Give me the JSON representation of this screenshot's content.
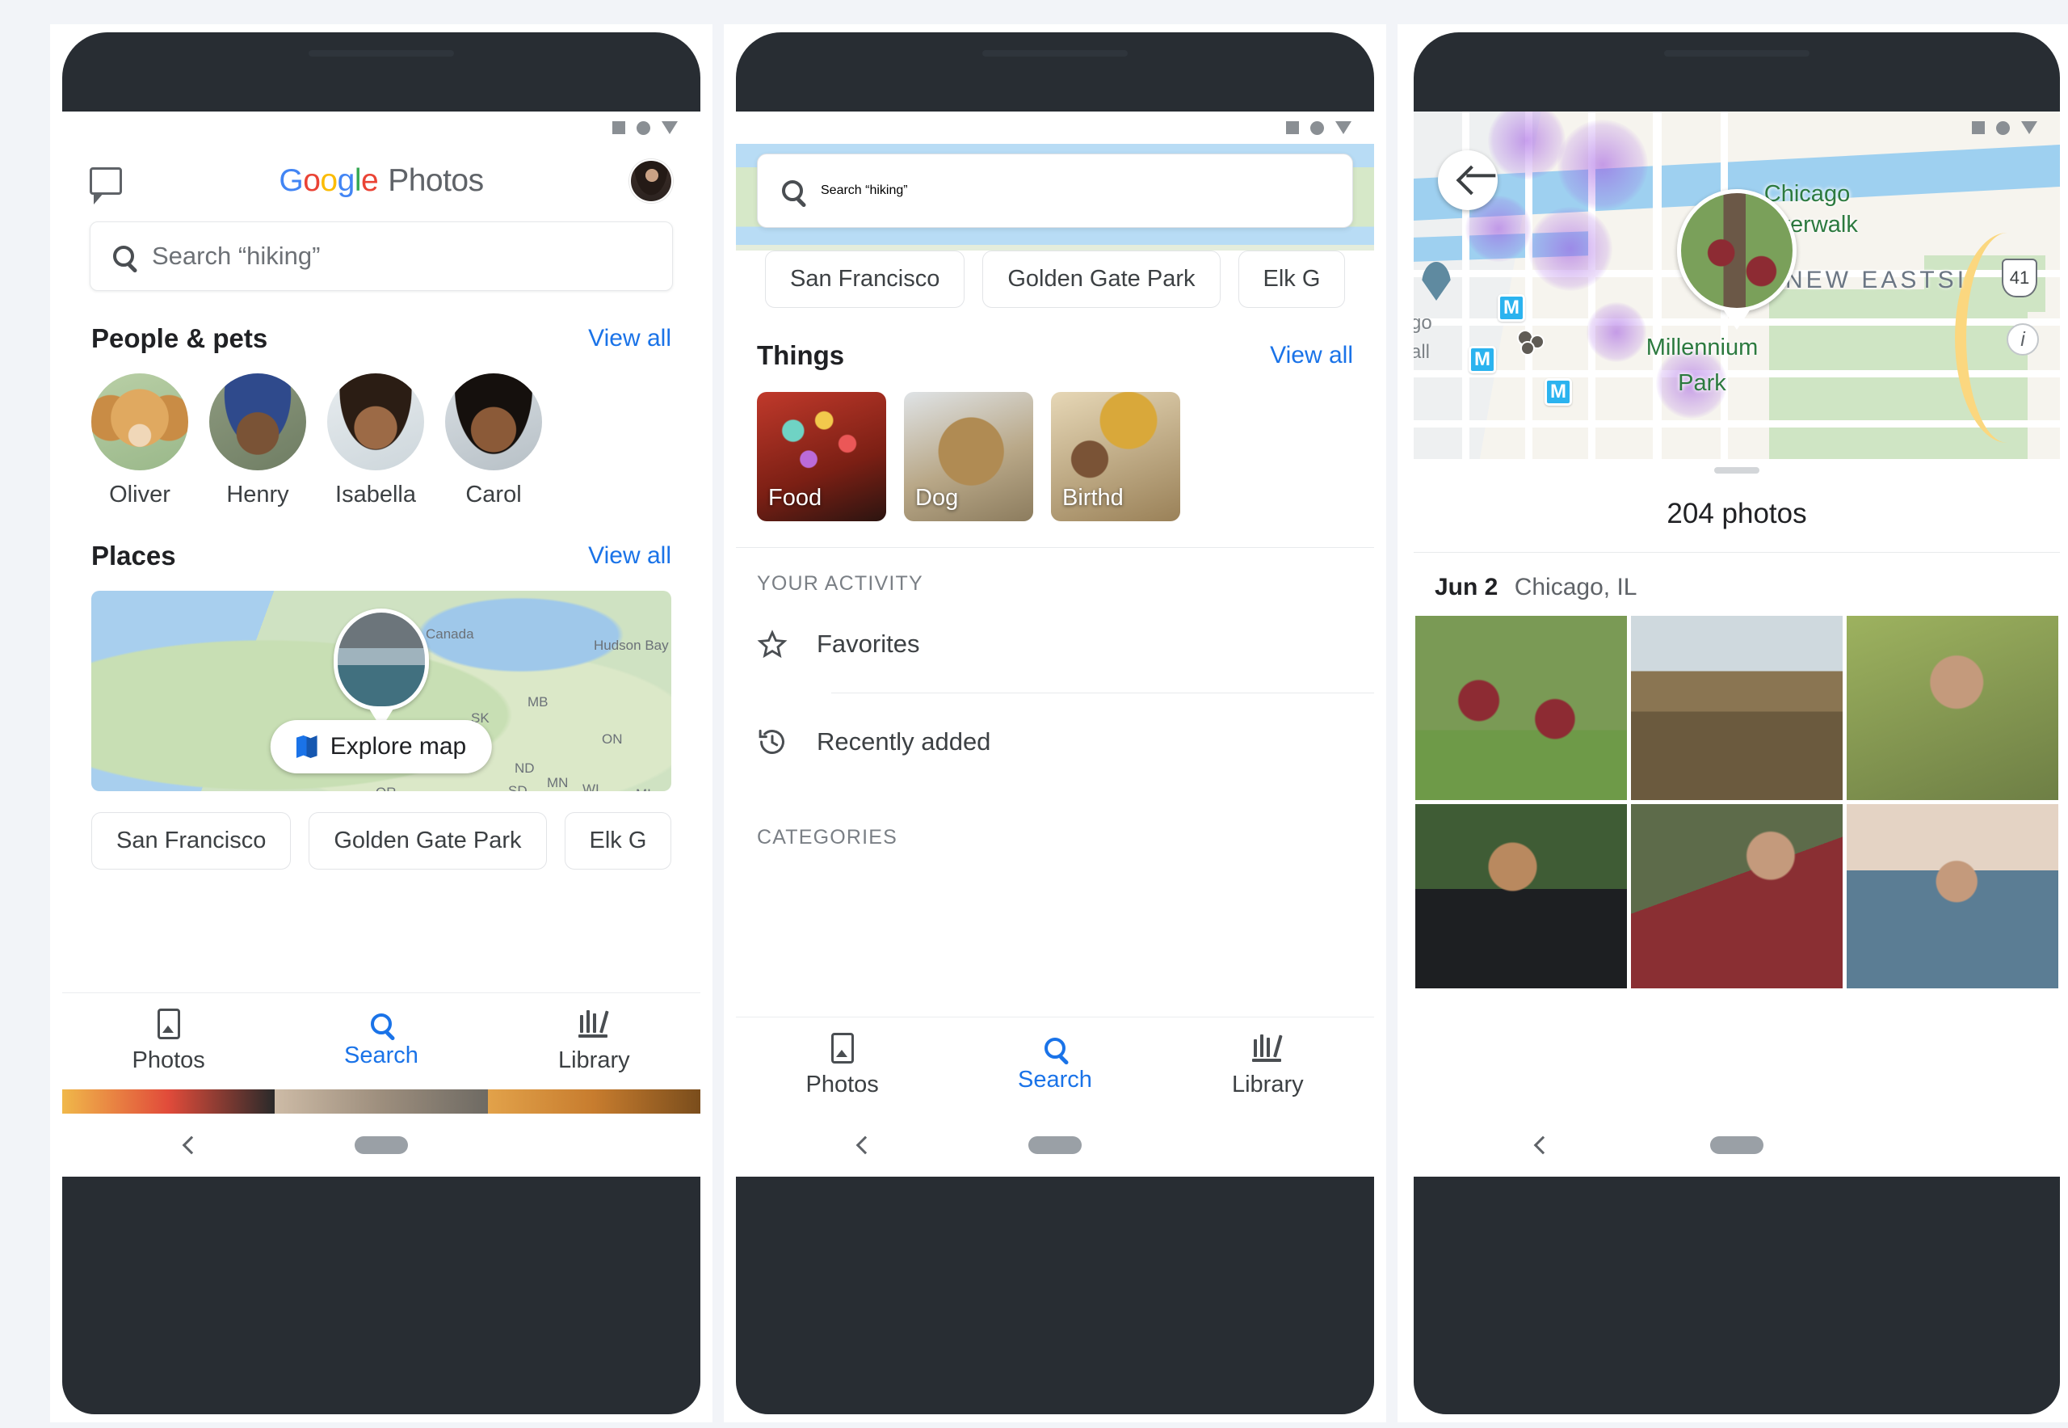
{
  "page": {
    "background_color": "#f2f4f8",
    "panel_color": "#ffffff",
    "device_frame_color": "#282d33",
    "accent_blue": "#1a73e8"
  },
  "status_bar": {
    "icons": [
      "square-icon",
      "circle-icon",
      "triangle-down-icon"
    ]
  },
  "system_nav": {
    "back_label": "back-chevron-icon",
    "home_label": "home-pill-icon"
  },
  "phone1": {
    "header": {
      "chat_icon": "chat-bubble-icon",
      "brand_google": "Google",
      "brand_product": "Photos",
      "avatar": "account-avatar"
    },
    "search": {
      "placeholder": "Search “hiking”",
      "icon": "search-icon"
    },
    "people_section": {
      "title": "People & pets",
      "view_all": "View all",
      "items": [
        {
          "name": "Oliver",
          "face": "f-dog"
        },
        {
          "name": "Henry",
          "face": "f-henry"
        },
        {
          "name": "Isabella",
          "face": "f-isabella"
        },
        {
          "name": "Carol",
          "face": "f-carol"
        }
      ]
    },
    "places_section": {
      "title": "Places",
      "view_all": "View all",
      "explore_button": "Explore map",
      "explore_icon": "map-icon",
      "map_labels": [
        "Canada",
        "Hudson Bay",
        "MB",
        "SK",
        "ON",
        "ND",
        "MN",
        "SD",
        "WI",
        "MI",
        "OR"
      ]
    },
    "chips": [
      "San Francisco",
      "Golden Gate Park",
      "Elk G"
    ],
    "bottom_nav": {
      "items": [
        {
          "label": "Photos",
          "icon": "photos-icon",
          "active": false
        },
        {
          "label": "Search",
          "icon": "search-icon",
          "active": true
        },
        {
          "label": "Library",
          "icon": "library-icon",
          "active": false
        }
      ]
    }
  },
  "phone2": {
    "search": {
      "placeholder": "Search “hiking”",
      "icon": "search-icon"
    },
    "chips": [
      "San Francisco",
      "Golden Gate Park",
      "Elk G"
    ],
    "things_section": {
      "title": "Things",
      "view_all": "View all",
      "tiles": [
        {
          "label": "Food",
          "art": "t-food"
        },
        {
          "label": "Dog",
          "art": "t-dog"
        },
        {
          "label": "Birthd",
          "art": "t-birthday"
        }
      ]
    },
    "activity_section": {
      "title": "YOUR ACTIVITY",
      "items": [
        {
          "label": "Favorites",
          "icon": "star-icon"
        },
        {
          "label": "Recently added",
          "icon": "history-icon"
        }
      ]
    },
    "categories_title": "CATEGORIES",
    "bottom_nav": {
      "items": [
        {
          "label": "Photos",
          "icon": "photos-icon",
          "active": false
        },
        {
          "label": "Search",
          "icon": "search-icon",
          "active": true
        },
        {
          "label": "Library",
          "icon": "library-icon",
          "active": false
        }
      ]
    }
  },
  "phone3": {
    "back_button": "back-arrow-icon",
    "map": {
      "labels": [
        {
          "text": "Chicago",
          "kind": "park-green"
        },
        {
          "text": "Riverwalk",
          "kind": "park-green"
        },
        {
          "text": "NEW EASTSI",
          "kind": "neighborhood-grey"
        },
        {
          "text": "Millennium",
          "kind": "park-green"
        },
        {
          "text": "Park",
          "kind": "park-green"
        },
        {
          "text": "go",
          "kind": "small-grey"
        },
        {
          "text": "all",
          "kind": "small-grey"
        }
      ],
      "transit_badges": [
        "M",
        "M",
        "M"
      ],
      "highway_shield": "41",
      "info_button": "info-icon",
      "photo_cluster": "photo-cluster-marker"
    },
    "photo_count": "204 photos",
    "date_group": {
      "date": "Jun 2",
      "place": "Chicago, IL"
    },
    "grid_cells": [
      "g1c",
      "g2c",
      "g3c",
      "g4c",
      "g5c",
      "g6c"
    ]
  }
}
